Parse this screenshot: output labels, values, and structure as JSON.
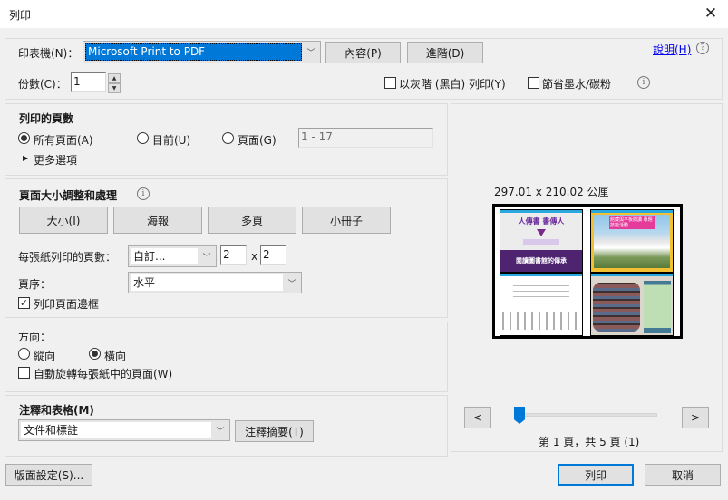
{
  "window": {
    "title": "列印",
    "close_label": "✕"
  },
  "printer": {
    "label": "印表機(N)：",
    "selected": "Microsoft Print to PDF",
    "properties_button": "內容(P)",
    "advanced_button": "進階(D)",
    "help_link": "說明(H)",
    "copies_label": "份數(C)：",
    "copies_value": "1",
    "grayscale_label": "以灰階 (黑白) 列印(Y)",
    "grayscale_checked": false,
    "save_ink_label": "節省墨水/碳粉",
    "save_ink_checked": false
  },
  "pages_to_print": {
    "heading": "列印的頁數",
    "options": [
      {
        "label": "所有頁面(A)",
        "selected": true
      },
      {
        "label": "目前(U)",
        "selected": false
      },
      {
        "label": "頁面(G)",
        "selected": false
      }
    ],
    "range_value": "1 - 17",
    "more_options": "更多選項"
  },
  "page_sizing": {
    "heading": "頁面大小調整和處理",
    "buttons": [
      "大小(I)",
      "海報",
      "多頁",
      "小冊子"
    ],
    "pages_per_sheet_label": "每張紙列印的頁數：",
    "pages_per_sheet_value": "自訂...",
    "cols": "2",
    "times": "x",
    "rows": "2",
    "page_order_label": "頁序：",
    "page_order_value": "水平",
    "print_border_label": "列印頁面邊框",
    "print_border_checked": true
  },
  "orientation": {
    "heading": "方向：",
    "options": [
      {
        "label": "縱向",
        "selected": false
      },
      {
        "label": "橫向",
        "selected": true
      }
    ],
    "auto_rotate_label": "自動旋轉每張紙中的頁面(W)",
    "auto_rotate_checked": false
  },
  "comments": {
    "heading": "注釋和表格(M)",
    "selected": "文件和標註",
    "summarize_button": "注釋摘要(T)"
  },
  "preview": {
    "paper_size": "297.01 x 210.02 公厘",
    "thumbs": [
      {
        "title": "人傳書 書傳人",
        "banner": "閱讀圖書館的傳承"
      },
      {
        "title": "館藏與平板閱讀 專題技能活動"
      },
      {
        "title": ""
      },
      {
        "title": ""
      }
    ],
    "prev_label": "<",
    "next_label": ">",
    "page_status": "第 1 頁，共 5 頁 (1)",
    "current_page": 1,
    "total_pages": 5
  },
  "footer": {
    "page_setup_button": "版面設定(S)...",
    "print_button": "列印",
    "cancel_button": "取消"
  }
}
